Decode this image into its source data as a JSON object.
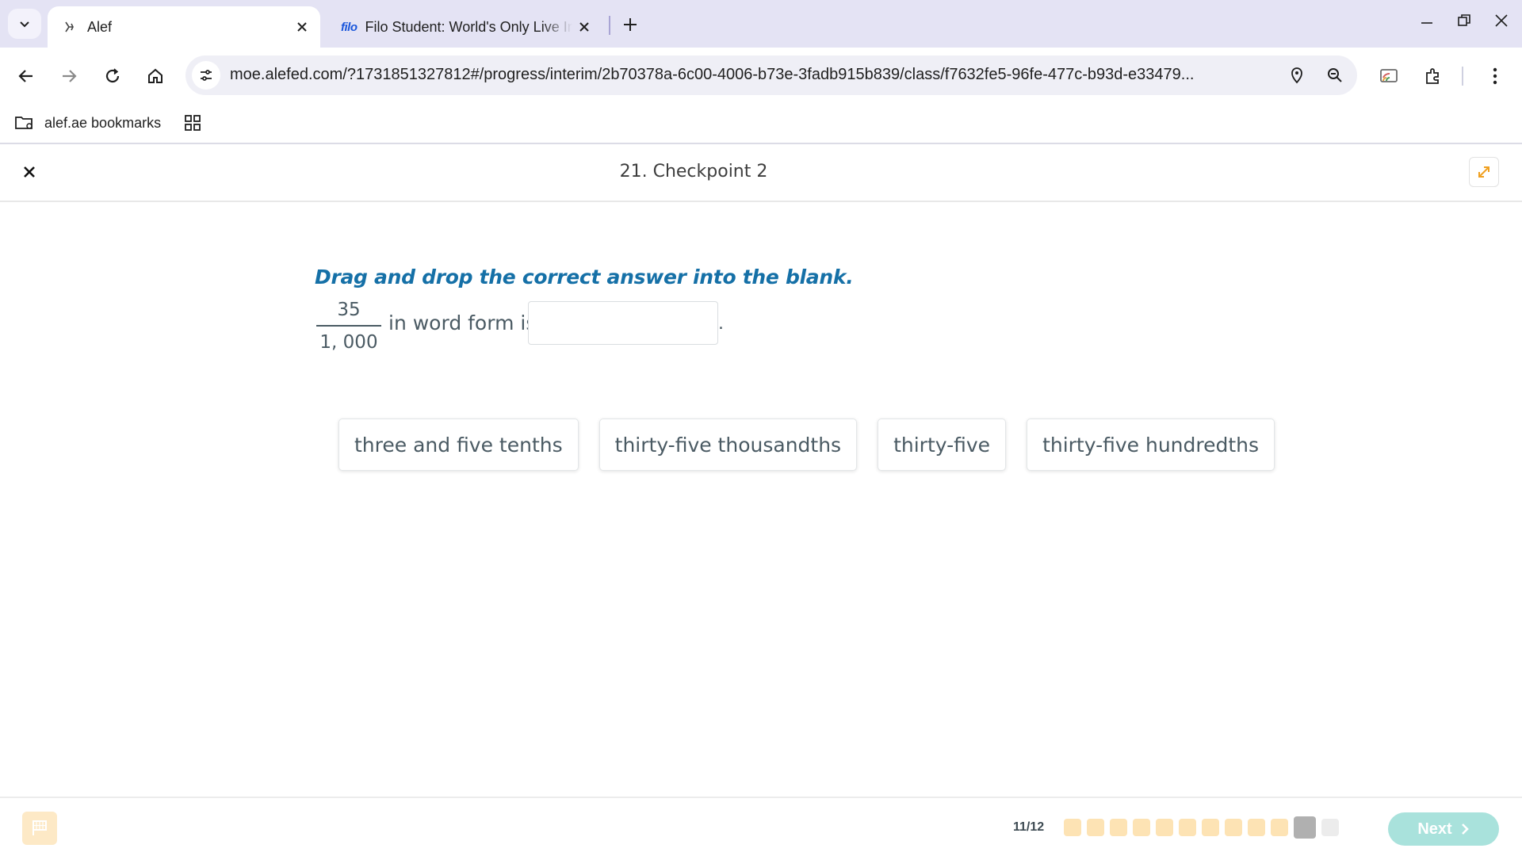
{
  "browser": {
    "tabs": [
      {
        "title": "Alef",
        "active": true,
        "icon": "alef-favicon"
      },
      {
        "title": "Filo Student: World's Only Live Instant Tutoring Platform",
        "active": false,
        "icon": "filo-favicon",
        "logo_text": "filo"
      }
    ],
    "url": "moe.alefed.com/?1731851327812#/progress/interim/2b70378a-6c00-4006-b73e-3fadb915b839/class/f7632fe5-96fe-477c-b93d-e33479...",
    "bookmarks": [
      {
        "label": "alef.ae bookmarks",
        "icon": "folder-icon"
      }
    ]
  },
  "header": {
    "title": "21. Checkpoint 2"
  },
  "question": {
    "instruction": "Drag and drop the correct answer into the blank.",
    "fraction": {
      "numerator": "35",
      "denominator": "1, 000"
    },
    "stem_text": "in word form is",
    "suffix": ".",
    "choices": [
      {
        "label": "three and five tenths"
      },
      {
        "label": "thirty-five thousandths"
      },
      {
        "label": "thirty-five"
      },
      {
        "label": "thirty-five hundredths"
      }
    ]
  },
  "footer": {
    "progress_text": "11/12",
    "total": 12,
    "current": 11,
    "next_label": "Next",
    "colors": {
      "completed": "#fde3b4",
      "current": "#b0b0b0",
      "pending": "#ececec",
      "next": "#a9e2dc"
    }
  }
}
